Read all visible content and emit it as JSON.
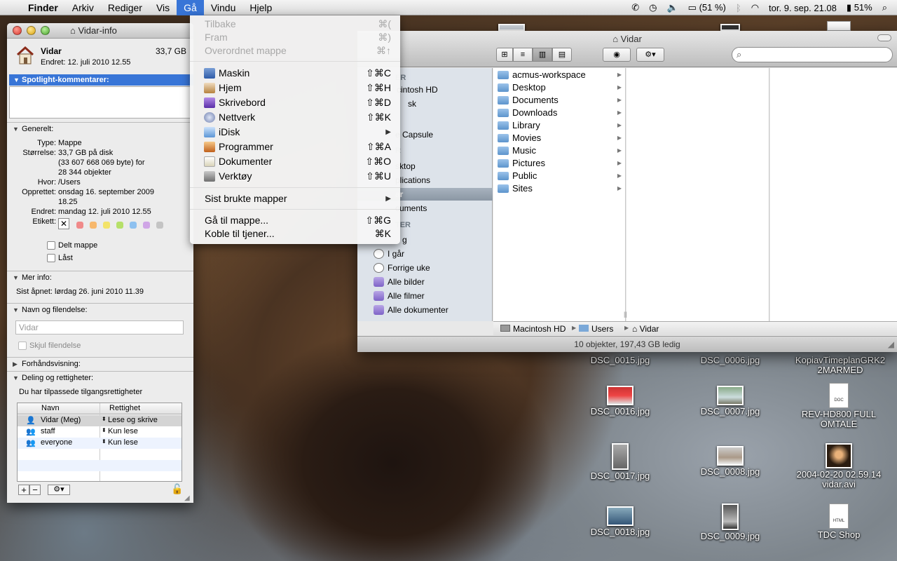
{
  "menubar": {
    "items": [
      "Finder",
      "Arkiv",
      "Rediger",
      "Vis",
      "Gå",
      "Vindu",
      "Hjelp"
    ],
    "active_index": 4,
    "battery_small": "(51 %)",
    "clock": "tor. 9. sep. 21.08",
    "battery": "51%"
  },
  "go_menu": {
    "items": [
      {
        "label": "Tilbake",
        "shortcut": "⌘(",
        "disabled": true
      },
      {
        "label": "Fram",
        "shortcut": "⌘)",
        "disabled": true
      },
      {
        "label": "Overordnet mappe",
        "shortcut": "⌘↑",
        "disabled": true
      },
      {
        "label": "Maskin",
        "shortcut": "⇧⌘C",
        "icon": "computer-icon"
      },
      {
        "label": "Hjem",
        "shortcut": "⇧⌘H",
        "icon": "home-icon"
      },
      {
        "label": "Skrivebord",
        "shortcut": "⇧⌘D",
        "icon": "desktop-icon"
      },
      {
        "label": "Nettverk",
        "shortcut": "⇧⌘K",
        "icon": "network-icon"
      },
      {
        "label": "iDisk",
        "shortcut": "▶",
        "icon": "idisk-icon"
      },
      {
        "label": "Programmer",
        "shortcut": "⇧⌘A",
        "icon": "applications-icon"
      },
      {
        "label": "Dokumenter",
        "shortcut": "⇧⌘O",
        "icon": "documents-icon"
      },
      {
        "label": "Verktøy",
        "shortcut": "⇧⌘U",
        "icon": "utilities-icon"
      },
      {
        "label": "Sist brukte mapper",
        "shortcut": "▶"
      },
      {
        "label": "Gå til mappe...",
        "shortcut": "⇧⌘G"
      },
      {
        "label": "Koble til tjener...",
        "shortcut": "⌘K"
      }
    ]
  },
  "info_window": {
    "title": "Vidar-info",
    "name": "Vidar",
    "size": "33,7 GB",
    "modified": "Endret:  12. juli 2010 12.55",
    "spotlight_header": "Spotlight-kommentarer:",
    "general_header": "Generelt:",
    "type_label": "Type:",
    "type_value": "Mappe",
    "size_label": "Størrelse:",
    "size_value_1": "33,7 GB på disk",
    "size_value_2": "(33 607 668 069 byte) for",
    "size_value_3": "28 344 objekter",
    "where_label": "Hvor:",
    "where_value": "/Users",
    "created_label": "Opprettet:",
    "created_value_1": "onsdag 16. september 2009",
    "created_value_2": "18.25",
    "modified_label": "Endret:",
    "modified_value": "mandag 12. juli 2010 12.55",
    "label_label": "Etikett:",
    "shared_label": "Delt mappe",
    "locked_label": "Låst",
    "more_info_header": "Mer info:",
    "last_opened": "Sist åpnet: lørdag 26. juni 2010 11.39",
    "name_ext_header": "Navn og filendelse:",
    "name_field": "Vidar",
    "hide_ext_label": "Skjul filendelse",
    "preview_header": "Forhåndsvisning:",
    "sharing_header": "Deling og rettigheter:",
    "custom_perms": "Du har tilpassede tilgangsrettigheter",
    "col_name": "Navn",
    "col_perm": "Rettighet",
    "perms": [
      {
        "name": "Vidar (Meg)",
        "perm": "Lese og skrive"
      },
      {
        "name": "staff",
        "perm": "Kun lese"
      },
      {
        "name": "everyone",
        "perm": "Kun lese"
      }
    ]
  },
  "finder": {
    "title": "Vidar",
    "sidebar_partial": [
      {
        "text": "ER",
        "kind": "head"
      },
      {
        "text": "cintosh HD"
      },
      {
        "text": "sk"
      },
      {
        "text": "e Capsule"
      },
      {
        "text": "R",
        "kind": "head"
      },
      {
        "text": "sktop"
      },
      {
        "text": "plications"
      },
      {
        "text": "ar",
        "selected": true
      },
      {
        "text": "cuments"
      },
      {
        "text": "TER",
        "kind": "head"
      },
      {
        "text": "g"
      },
      {
        "text": "I går"
      },
      {
        "text": "Forrige uke"
      },
      {
        "text": "Alle bilder"
      },
      {
        "text": "Alle filmer"
      },
      {
        "text": "Alle dokumenter"
      }
    ],
    "folders": [
      "acmus-workspace",
      "Desktop",
      "Documents",
      "Downloads",
      "Library",
      "Movies",
      "Music",
      "Pictures",
      "Public",
      "Sites"
    ],
    "path": [
      "Macintosh HD",
      "Users",
      "Vidar"
    ],
    "status": "10 objekter, 197,43 GB ledig"
  },
  "desktop_icons": [
    {
      "label": "DSC_0015.jpg"
    },
    {
      "label": "DSC_0006.jpg"
    },
    {
      "label": "KopiavTimeplanGRK2 2MARMED"
    },
    {
      "label": "DSC_0016.jpg"
    },
    {
      "label": "DSC_0007.jpg"
    },
    {
      "label": "REV-HD800 FULL OMTALE",
      "doc": "DOC"
    },
    {
      "label": "DSC_0017.jpg"
    },
    {
      "label": "DSC_0008.jpg"
    },
    {
      "label": "2004-02-20 02.59.14 vidar.avi"
    },
    {
      "label": "DSC_0018.jpg"
    },
    {
      "label": "DSC_0009.jpg"
    },
    {
      "label": "TDC Shop",
      "doc": "HTML"
    }
  ],
  "colors": {
    "selection": "#3875d7",
    "sidebar": "#dde3ea",
    "folder": "#6d9ed3"
  }
}
